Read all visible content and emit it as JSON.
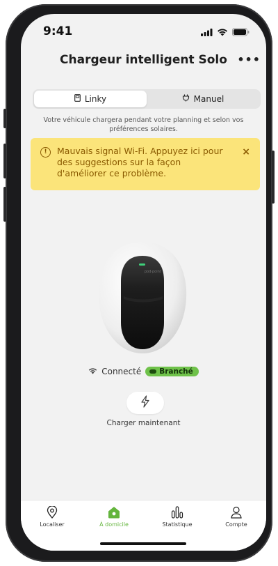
{
  "status_bar": {
    "time": "9:41"
  },
  "header": {
    "title": "Chargeur intelligent Solo",
    "more": "•••"
  },
  "mode_toggle": {
    "tabs": [
      {
        "label": "Linky",
        "icon": "meter-icon",
        "selected": true
      },
      {
        "label": "Manuel",
        "icon": "plug-icon",
        "selected": false
      }
    ]
  },
  "subtitle": "Votre véhicule chargera pendant votre planning et selon vos préférences solaires.",
  "alert": {
    "text": "Mauvais signal Wi-Fi. Appuyez ici pour des suggestions sur la façon d'améliorer ce problème.",
    "icon": "info-icon",
    "close": "×",
    "color": "#fbe47a"
  },
  "charger": {
    "brand": "pod·point"
  },
  "connection": {
    "wifi_label": "Connecté",
    "plug_label": "Branché",
    "badge_color": "#6fc24a"
  },
  "charge_now": {
    "label": "Charger maintenant",
    "icon": "bolt-icon"
  },
  "tabbar": {
    "accent": "#64b53d",
    "items": [
      {
        "label": "Localiser",
        "icon": "location-pin-icon"
      },
      {
        "label": "À domicile",
        "icon": "home-icon",
        "active": true
      },
      {
        "label": "Statistique",
        "icon": "bar-chart-icon"
      },
      {
        "label": "Compte",
        "icon": "person-icon"
      }
    ]
  }
}
